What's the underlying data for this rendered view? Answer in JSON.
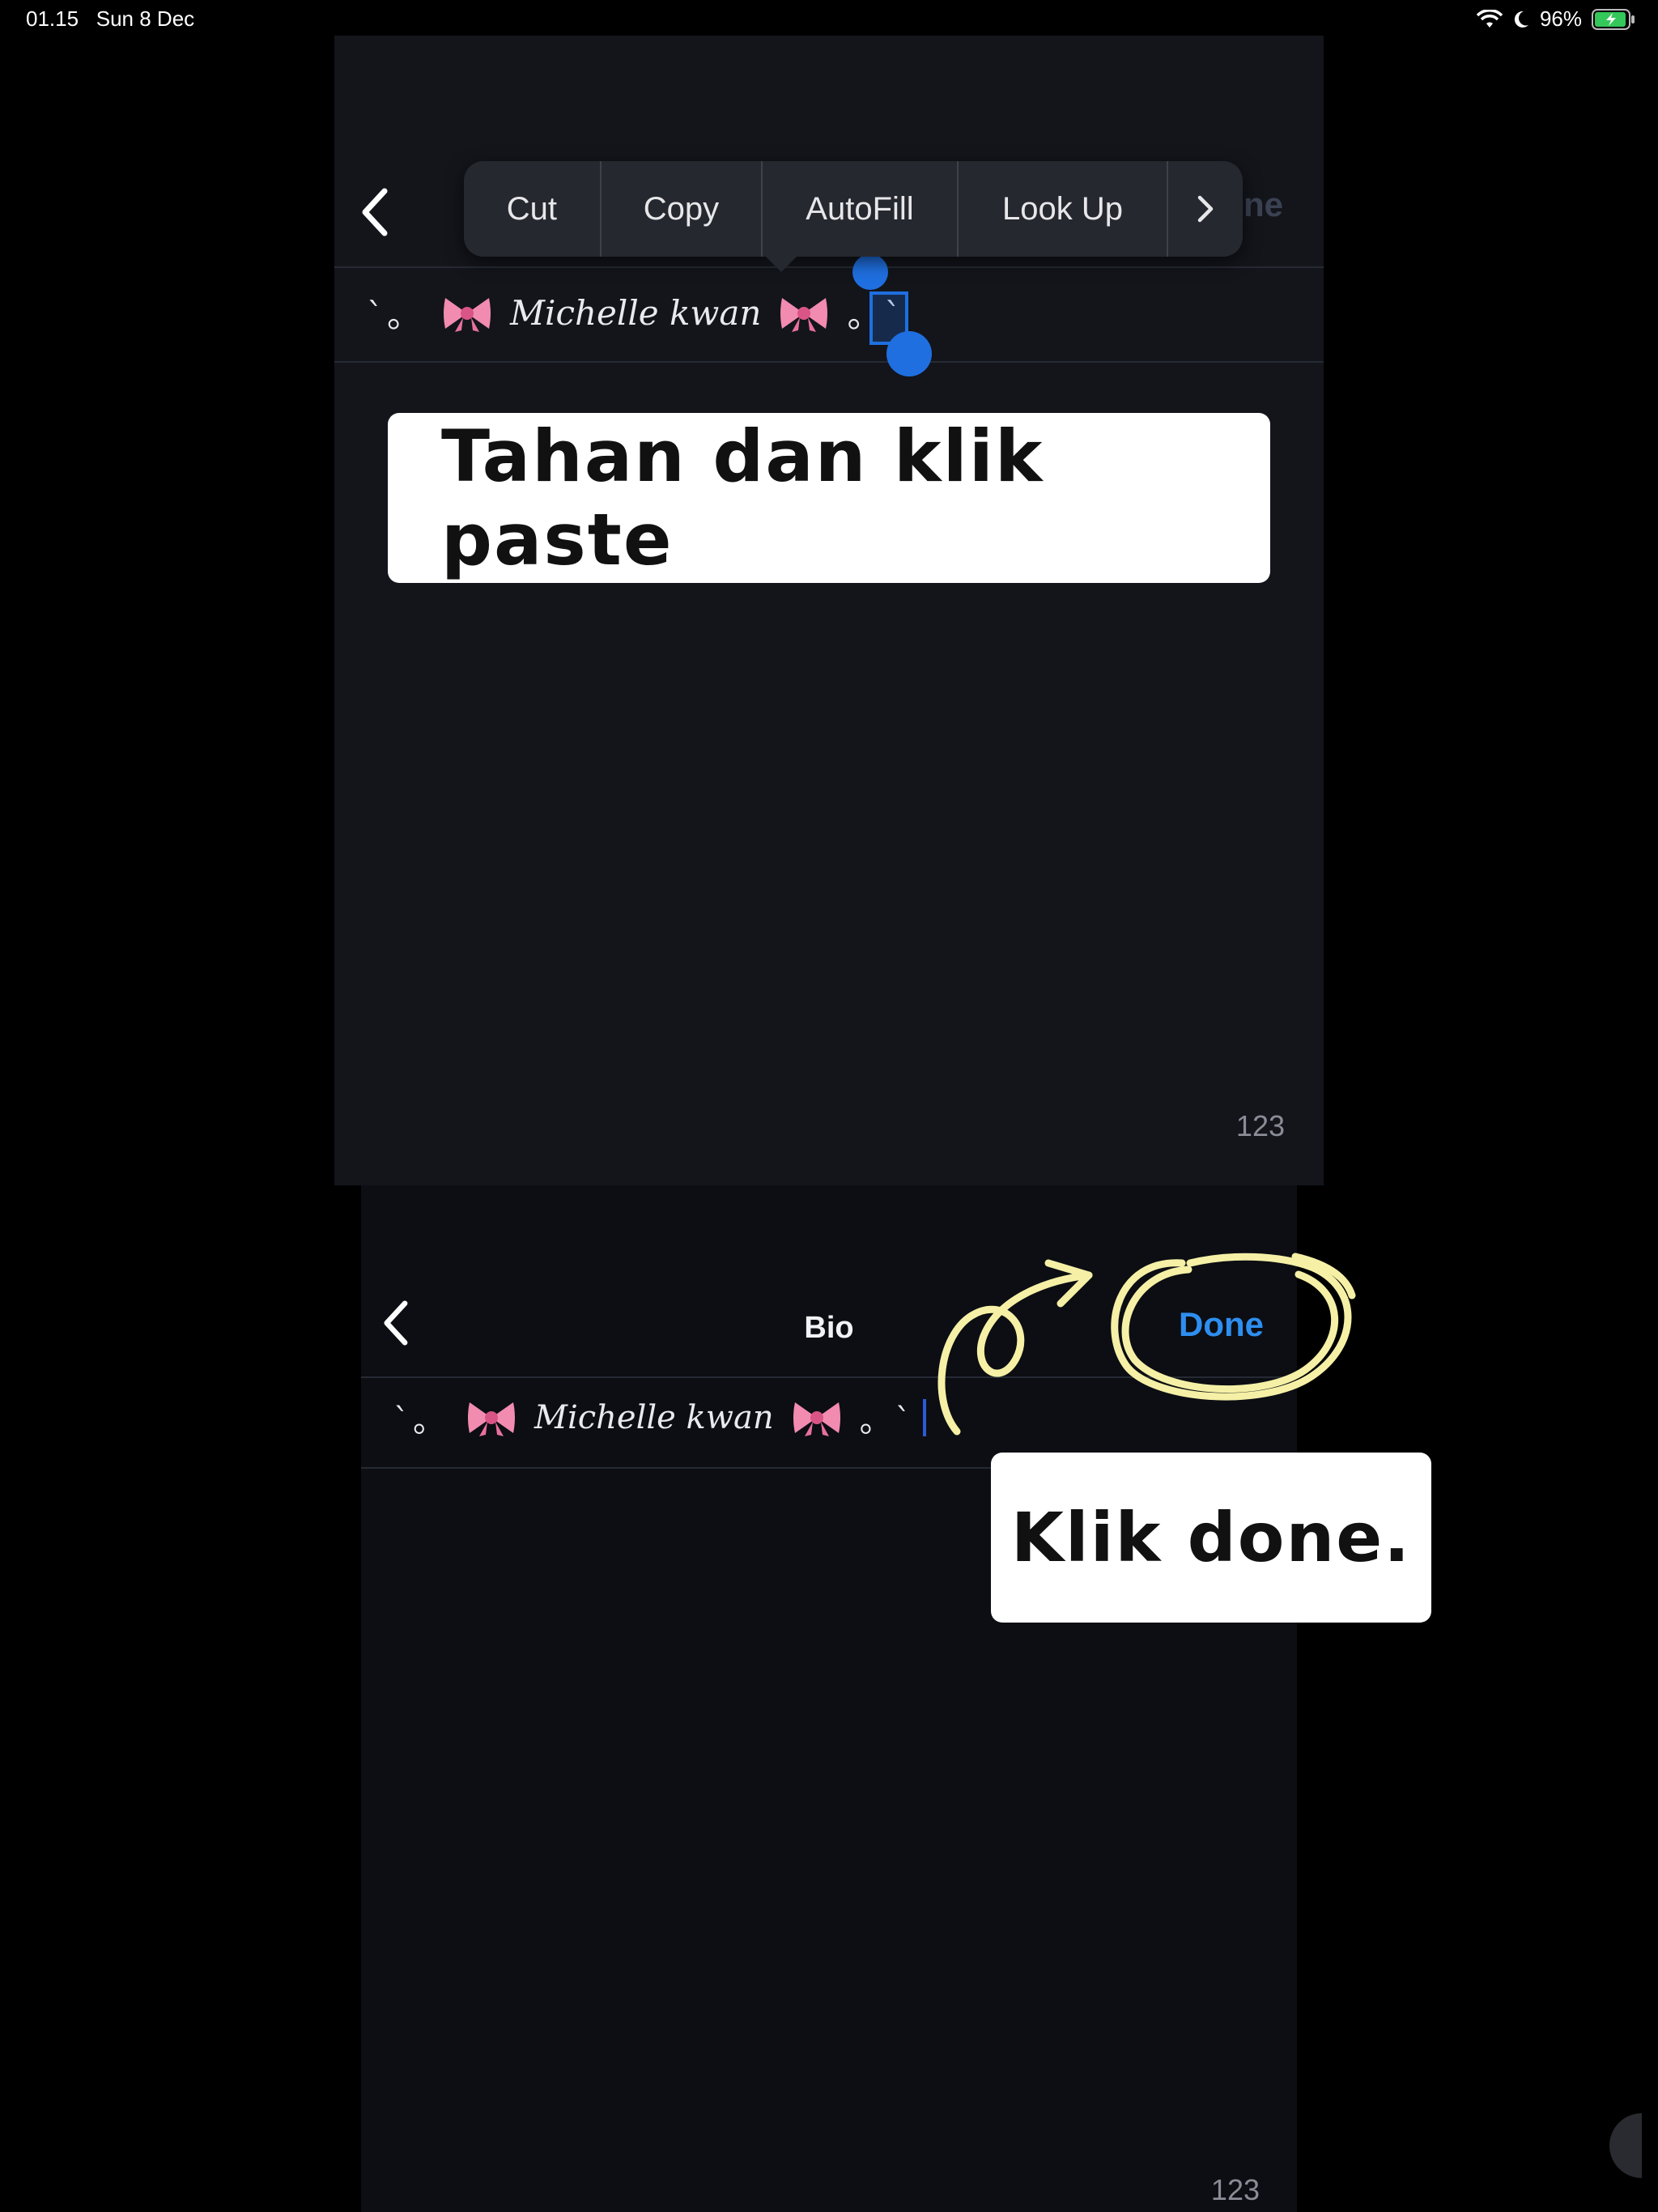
{
  "status_bar": {
    "time": "01.15",
    "date": "Sun 8 Dec",
    "battery": "96%",
    "icons": [
      "wifi-icon",
      "moon-icon",
      "battery-charging-icon"
    ]
  },
  "top_screen": {
    "done_label": "ne",
    "bio_text": "Michelle kwan",
    "bio_prefix": "`。",
    "bio_suffix": "。`",
    "counter": "123",
    "context_menu": {
      "items": [
        "Cut",
        "Copy",
        "AutoFill",
        "Look Up"
      ],
      "more_icon": "chevron-right-icon"
    },
    "instruction": "Tahan dan klik paste"
  },
  "bottom_screen": {
    "title": "Bio",
    "done_label": "Done",
    "bio_text": "Michelle kwan",
    "bio_prefix": "`。",
    "bio_suffix": "。`",
    "counter": "123",
    "instruction": "Klik done."
  },
  "colors": {
    "accent_blue": "#2e8ef0",
    "selection_blue": "#1f6fe0",
    "highlight_yellow": "#f5f0a6"
  }
}
